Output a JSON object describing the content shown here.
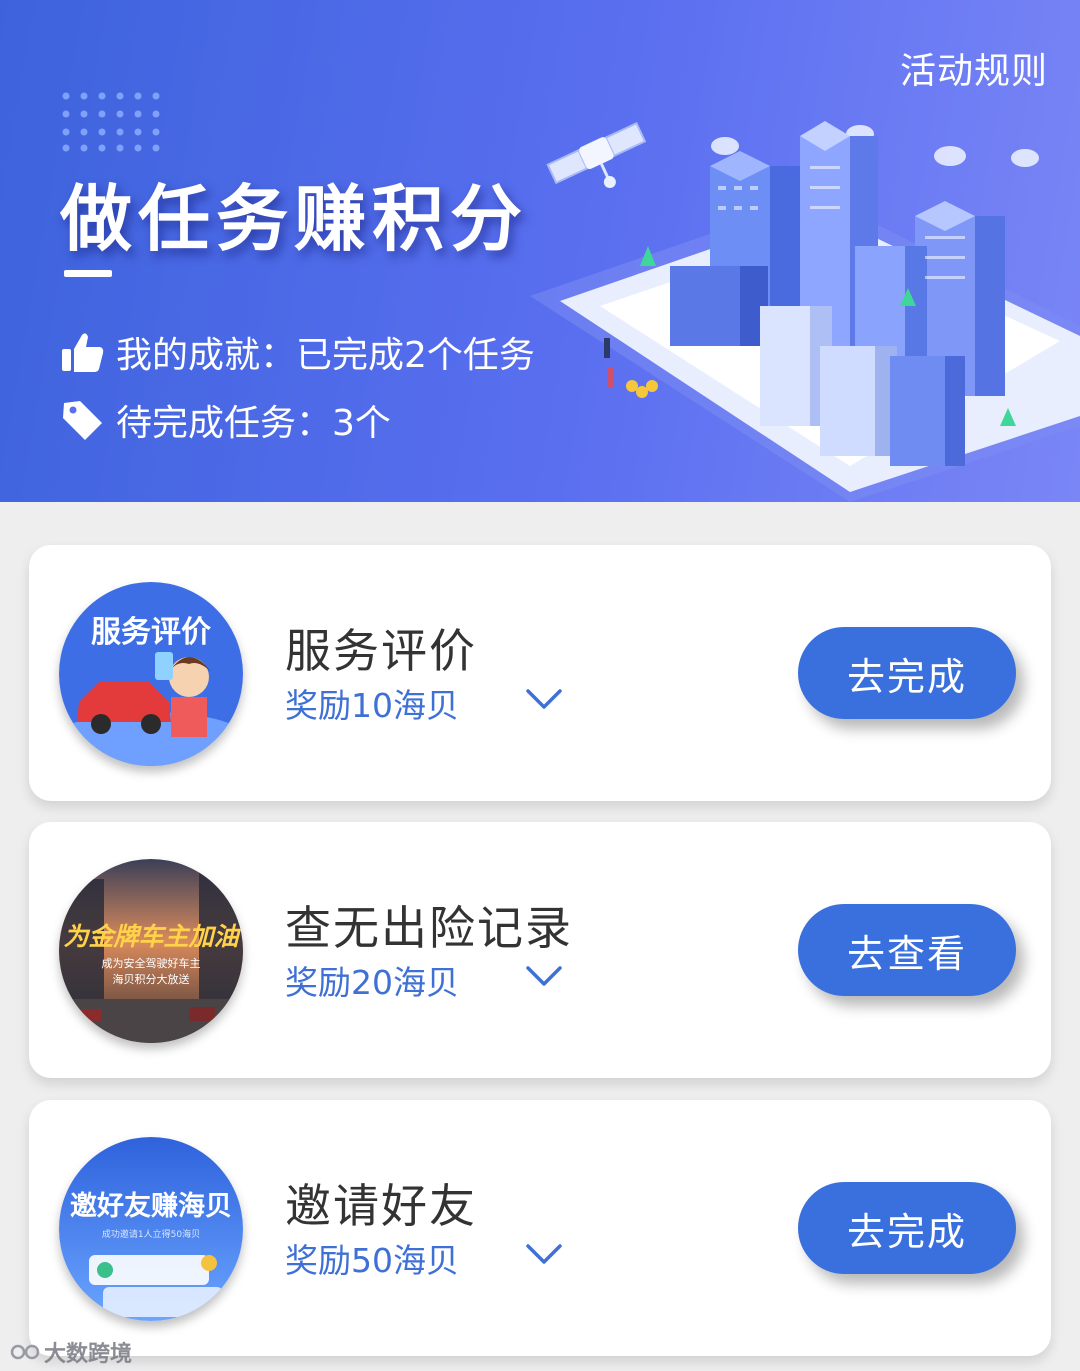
{
  "header": {
    "rules_link": "活动规则",
    "title": "做任务赚积分",
    "achievement_text": "我的成就：已完成2个任务",
    "pending_text": "待完成任务：3个"
  },
  "tasks": [
    {
      "thumb_text": "服务评价",
      "name": "服务评价",
      "reward": "奖励10海贝",
      "button": "去完成"
    },
    {
      "thumb_text": "为金牌车主加油",
      "thumb_subtext_1": "成为安全驾驶好车主",
      "thumb_subtext_2": "海贝积分大放送",
      "name": "查无出险记录",
      "reward": "奖励20海贝",
      "button": "去查看"
    },
    {
      "thumb_text": "邀好友赚海贝",
      "thumb_subtext_1": "成功邀请1人立得50海贝",
      "name": "邀请好友",
      "reward": "奖励50海贝",
      "button": "去完成"
    }
  ],
  "watermark": "大数跨境",
  "colors": {
    "banner_start": "#3d63dc",
    "banner_end": "#7a86f6",
    "accent": "#3a70dd",
    "reward_text": "#3f70d6"
  },
  "icons": {
    "achievement": "thumbs-up-icon",
    "pending": "tag-icon",
    "expand": "chevron-down-icon"
  }
}
